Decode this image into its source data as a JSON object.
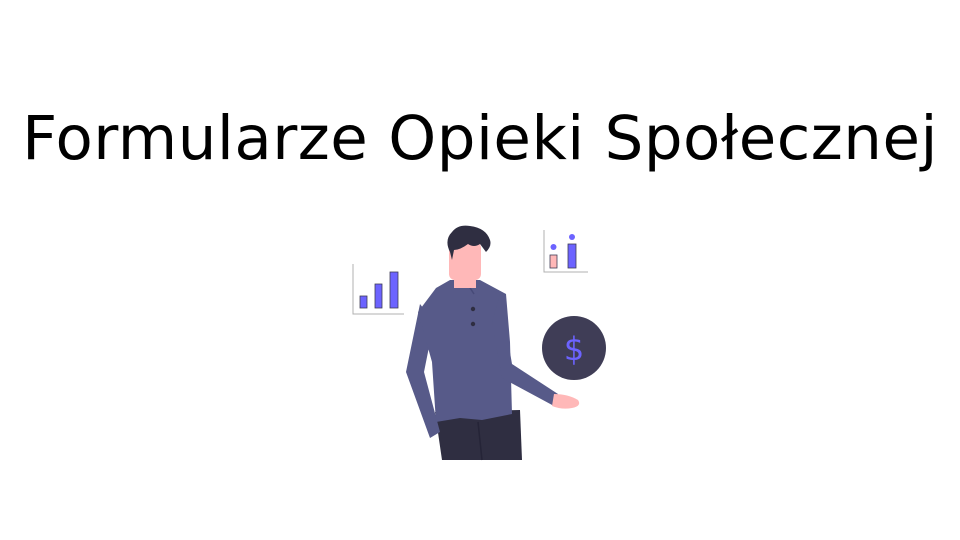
{
  "slide": {
    "title": "Formularze Opieki Społecznej"
  },
  "illustration": {
    "coin_symbol": "$",
    "colors": {
      "shirt": "#575a89",
      "pants": "#2f2e41",
      "hair": "#2f2e41",
      "skin": "#ffb8b8",
      "coin": "#3f3d56",
      "accent": "#6c63ff",
      "bar_pink": "#ffb8b8",
      "axis": "#b0b0b0"
    }
  }
}
